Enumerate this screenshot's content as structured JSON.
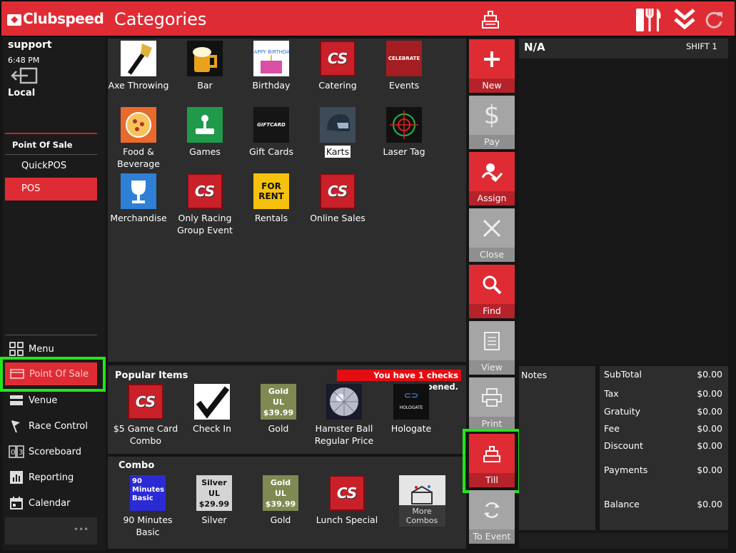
{
  "app": {
    "brand": "Clubspeed",
    "title": "Categories"
  },
  "sidebar": {
    "user": "support",
    "time": "6:48 PM",
    "location": "Local",
    "section_header": "Point Of Sale",
    "sub_items": [
      {
        "label": "QuickPOS"
      },
      {
        "label": "POS"
      }
    ],
    "nav": [
      {
        "label": "Menu"
      },
      {
        "label": "Point Of Sale"
      },
      {
        "label": "Venue"
      },
      {
        "label": "Race Control"
      },
      {
        "label": "Scoreboard"
      },
      {
        "label": "Reporting"
      },
      {
        "label": "Calendar"
      }
    ],
    "more": "•••"
  },
  "categories": [
    {
      "label": "Axe Throwing"
    },
    {
      "label": "Bar"
    },
    {
      "label": "Birthday",
      "img_text": "HAPPY BIRTHDAY"
    },
    {
      "label": "Catering",
      "img_text": "CS"
    },
    {
      "label": "Events",
      "img_text": "CELEBRATE"
    },
    {
      "label": "Food & Beverage"
    },
    {
      "label": "Games"
    },
    {
      "label": "Gift Cards",
      "img_text": "GIFTCARD"
    },
    {
      "label": "Karts"
    },
    {
      "label": "Laser Tag"
    },
    {
      "label": "Merchandise"
    },
    {
      "label": "Only Racing Group Event",
      "img_text": "CS"
    },
    {
      "label": "Rentals",
      "img_text": "FOR RENT"
    },
    {
      "label": "Online Sales",
      "img_text": "CS"
    }
  ],
  "popular": {
    "title": "Popular Items",
    "alert": "You have 1 checks opened.",
    "items": [
      {
        "label": "$5 Game Card Combo",
        "img_text": "CS"
      },
      {
        "label": "Check In"
      },
      {
        "label": "Gold",
        "img_lines": [
          "Gold",
          "UL",
          "$39.99"
        ]
      },
      {
        "label": "Hamster Ball Regular Price"
      },
      {
        "label": "Hologate",
        "img_text": "HOLOGATE"
      }
    ]
  },
  "combo": {
    "title": "Combo",
    "items": [
      {
        "label": "90 Minutes Basic",
        "img_lines": [
          "90",
          "Minutes",
          "Basic"
        ]
      },
      {
        "label": "Silver",
        "img_lines": [
          "Silver",
          "UL",
          "$29.99"
        ]
      },
      {
        "label": "Gold",
        "img_lines": [
          "Gold",
          "UL",
          "$39.99"
        ]
      },
      {
        "label": "Lunch Special",
        "img_text": "CS"
      },
      {
        "label": "More Combos",
        "img_lines": [
          "More",
          "Combos"
        ]
      }
    ]
  },
  "actions": [
    {
      "label": "New",
      "icon": "plus-icon"
    },
    {
      "label": "Pay",
      "icon": "dollar-icon"
    },
    {
      "label": "Assign",
      "icon": "assign-icon"
    },
    {
      "label": "Close",
      "icon": "x-icon"
    },
    {
      "label": "Find",
      "icon": "search-icon"
    },
    {
      "label": "View",
      "icon": "document-icon"
    },
    {
      "label": "Print",
      "icon": "printer-icon"
    },
    {
      "label": "Till",
      "icon": "cash-register-icon"
    },
    {
      "label": "To Event",
      "icon": "refresh-icon"
    }
  ],
  "ticket": {
    "customer": "N/A",
    "shift": "SHIFT 1",
    "notes_label": "Notes"
  },
  "totals": [
    {
      "label": "SubTotal",
      "value": "$0.00"
    },
    {
      "label": "Tax",
      "value": "$0.00"
    },
    {
      "label": "Gratuity",
      "value": "$0.00"
    },
    {
      "label": "Fee",
      "value": "$0.00"
    },
    {
      "label": "Discount",
      "value": "$0.00"
    },
    {
      "label": "Payments",
      "value": "$0.00"
    },
    {
      "label": "Balance",
      "value": "$0.00"
    }
  ],
  "colors": {
    "brand_red": "#df2c34",
    "highlight_green": "#25e41e",
    "panel": "#2d2d2d"
  }
}
